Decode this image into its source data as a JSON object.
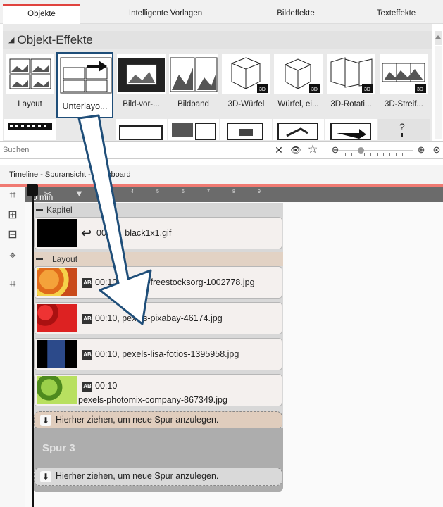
{
  "tabs": [
    "Objekte",
    "Intelligente Vorlagen",
    "Bildeffekte",
    "Texteffekte"
  ],
  "section": {
    "title": "Objekt-Effekte"
  },
  "effects": [
    {
      "label": "Layout"
    },
    {
      "label": "Unterlayo..."
    },
    {
      "label": "Bild-vor-..."
    },
    {
      "label": "Bildband"
    },
    {
      "label": "3D-Würfel"
    },
    {
      "label": "Würfel, ei..."
    },
    {
      "label": "3D-Rotati..."
    },
    {
      "label": "3D-Streif..."
    }
  ],
  "search": {
    "placeholder": "Suchen",
    "close_glyph": "✕",
    "eye_glyph": "👁",
    "star_glyph": "☆"
  },
  "timeline": {
    "header": "Timeline - Spuransicht - Storyboard",
    "ruler_label": "0 min",
    "ticks": [
      "4",
      "5",
      "6",
      "7",
      "8",
      "9"
    ]
  },
  "tracks": {
    "chapter_label": "Kapitel",
    "chapter_clip": "00:1… black1x1.gif",
    "layout_label": "Layout",
    "clips": [
      {
        "text": "00:10, pexels-freestocksorg-1002778.jpg",
        "ab": "AB",
        "color": "#e07a2a"
      },
      {
        "text": "00:10, pexels-pixabay-46174.jpg",
        "ab": "AB",
        "color": "#c0282a"
      },
      {
        "text": "00:10, pexels-lisa-fotios-1395958.jpg",
        "ab": "AB",
        "color": "#2a3f7a"
      },
      {
        "text": "00:10",
        "text2": "pexels-photomix-company-867349.jpg",
        "ab": "AB",
        "color": "#6aa832"
      }
    ],
    "drop_text": "Hierher ziehen, um neue Spur anzulegen.",
    "spur_name": "Spur 3"
  },
  "colors": {
    "accent": "#e0443f",
    "selection": "#1f4e79",
    "arrow_fill": "#ffffff"
  }
}
